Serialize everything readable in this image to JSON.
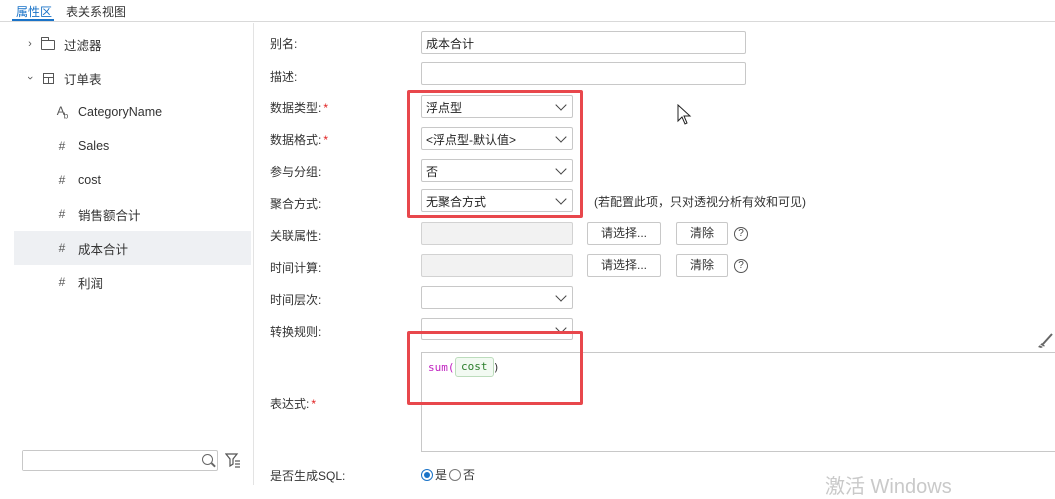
{
  "tabs": [
    {
      "label": "属性区",
      "active": true
    },
    {
      "label": "表关系视图",
      "active": false
    }
  ],
  "tree": {
    "folder": {
      "label": "过滤器",
      "icon": "folder-icon"
    },
    "table": {
      "label": "订单表",
      "icon": "table-icon"
    },
    "fields": [
      {
        "label": "CategoryName",
        "icon": "text-field-icon",
        "glyph": "Ab"
      },
      {
        "label": "Sales",
        "icon": "number-field-icon",
        "glyph": "#"
      },
      {
        "label": "cost",
        "icon": "number-field-icon",
        "glyph": "#"
      },
      {
        "label": "销售额合计",
        "icon": "number-field-icon",
        "glyph": "#"
      },
      {
        "label": "成本合计",
        "icon": "number-field-icon",
        "glyph": "#",
        "selected": true
      },
      {
        "label": "利润",
        "icon": "number-field-icon",
        "glyph": "#"
      }
    ],
    "search_placeholder": ""
  },
  "form": {
    "alias": {
      "label": "别名:",
      "value": "成本合计"
    },
    "description": {
      "label": "描述:",
      "value": ""
    },
    "data_type": {
      "label": "数据类型:",
      "required": "*",
      "value": "浮点型"
    },
    "data_format": {
      "label": "数据格式:",
      "required": "*",
      "value": "<浮点型-默认值>"
    },
    "grouping": {
      "label": "参与分组:",
      "value": "否"
    },
    "aggregation": {
      "label": "聚合方式:",
      "value": "无聚合方式",
      "note": "(若配置此项，只对透视分析有效和可见)"
    },
    "related_attr": {
      "label": "关联属性:",
      "select_label": "请选择...",
      "clear_label": "清除",
      "help": "?"
    },
    "time_calc": {
      "label": "时间计算:",
      "select_label": "请选择...",
      "clear_label": "清除",
      "help": "?"
    },
    "time_level": {
      "label": "时间层次:",
      "value": ""
    },
    "conversion_rule": {
      "label": "转换规则:",
      "value": ""
    },
    "expression": {
      "label": "表达式:",
      "required": "*",
      "fn_open": "sum(",
      "field": "cost",
      "fn_close": ")"
    },
    "generate_sql": {
      "label": "是否生成SQL:",
      "yes": "是",
      "no": "否",
      "selected": "yes"
    }
  },
  "watermark": "激活 Windows",
  "colors": {
    "accent": "#1a73c8",
    "highlight_box": "#e8474c",
    "required": "#e02020"
  }
}
